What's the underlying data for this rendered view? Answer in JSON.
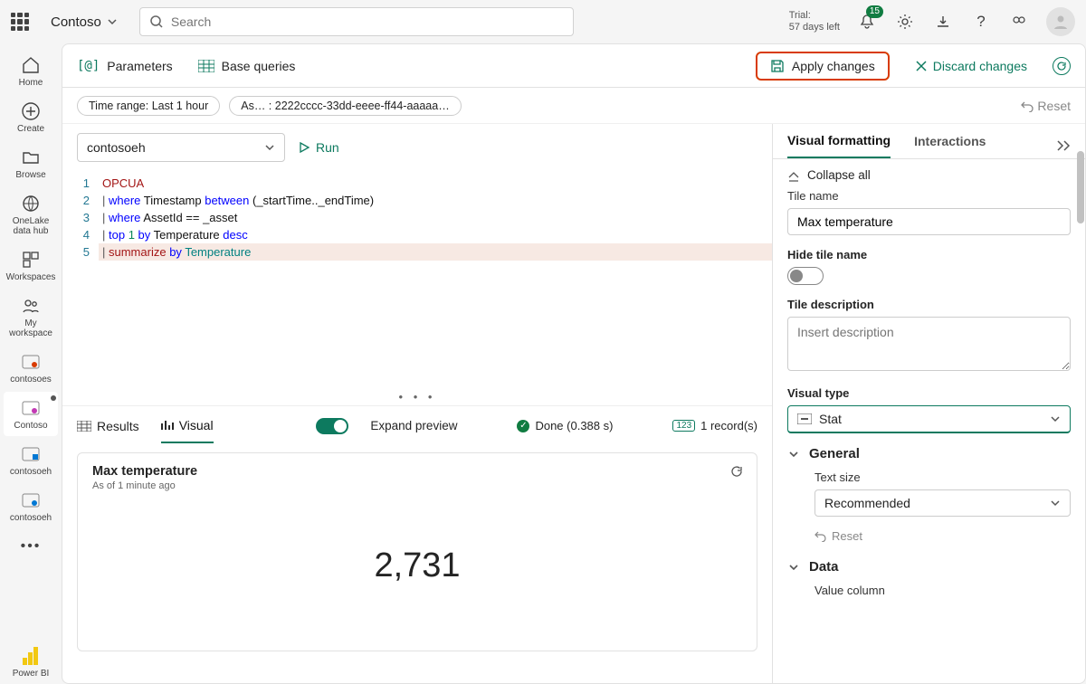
{
  "top": {
    "tenant": "Contoso",
    "search_placeholder": "Search",
    "trial_line1": "Trial:",
    "trial_line2": "57 days left",
    "notif_count": "15"
  },
  "nav": {
    "home": "Home",
    "create": "Create",
    "browse": "Browse",
    "onelake": "OneLake data hub",
    "workspaces": "Workspaces",
    "myws": "My workspace",
    "contosoes": "contosoes",
    "contoso": "Contoso",
    "contosoeh1": "contosoeh",
    "contosoeh2": "contosoeh",
    "powerbi": "Power BI"
  },
  "actionbar": {
    "parameters": "Parameters",
    "basequeries": "Base queries",
    "apply": "Apply changes",
    "discard": "Discard changes"
  },
  "filters": {
    "timerange": "Time range: Last 1 hour",
    "asset": "As… : 2222cccc-33dd-eeee-ff44-aaaaa…",
    "reset": "Reset"
  },
  "query": {
    "datasource": "contosoeh",
    "run": "Run",
    "lines": {
      "l1": "OPCUA",
      "l2a": "| ",
      "l2b": "where",
      "l2c": " Timestamp ",
      "l2d": "between",
      "l2e": " (_startTime.._endTime)",
      "l3a": "| ",
      "l3b": "where",
      "l3c": " AssetId == _asset",
      "l4a": "| ",
      "l4b": "top",
      "l4c": " 1 ",
      "l4d": "by",
      "l4e": " Temperature ",
      "l4f": "desc",
      "l5a": "| ",
      "l5b": "summarize",
      "l5c": " ",
      "l5d": "by",
      "l5e": " Temperature"
    },
    "linenums": [
      "1",
      "2",
      "3",
      "4",
      "5"
    ]
  },
  "results": {
    "tab_results": "Results",
    "tab_visual": "Visual",
    "expand": "Expand preview",
    "done": "Done (0.388 s)",
    "records": "1 record(s)"
  },
  "card": {
    "title": "Max temperature",
    "subtitle": "As of 1 minute ago",
    "value": "2,731"
  },
  "panel": {
    "tab_visual": "Visual formatting",
    "tab_interactions": "Interactions",
    "collapse_all": "Collapse all",
    "tile_name_label": "Tile name",
    "tile_name_value": "Max temperature",
    "hide_tile_label": "Hide tile name",
    "tile_desc_label": "Tile description",
    "tile_desc_placeholder": "Insert description",
    "visual_type_label": "Visual type",
    "visual_type_value": "Stat",
    "general": "General",
    "text_size_label": "Text size",
    "text_size_value": "Recommended",
    "reset": "Reset",
    "data": "Data",
    "value_column_label": "Value column"
  }
}
